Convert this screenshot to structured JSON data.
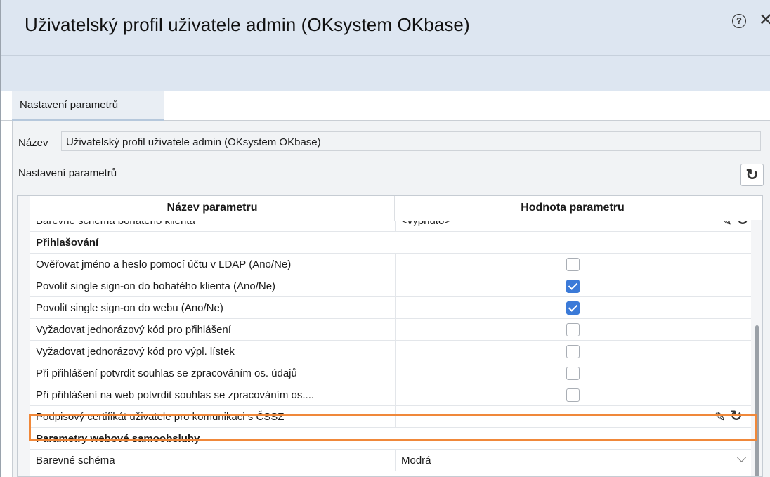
{
  "window": {
    "title": "Uživatelský profil uživatele admin (OKsystem OKbase)",
    "help_glyph": "?",
    "close_glyph": "✕"
  },
  "tabs": [
    {
      "label": "Nastavení parametrů",
      "active": true
    }
  ],
  "form": {
    "name_label": "Název",
    "name_value": "Uživatelský profil uživatele admin (OKsystem OKbase)",
    "section_label": "Nastavení parametrů"
  },
  "grid": {
    "columns": [
      "Název parametru",
      "Hodnota parametru"
    ],
    "partial_row": {
      "name": "Barevné schéma bohatého klienta",
      "value": "<vypnuto>"
    },
    "groups": [
      {
        "label": "Přihlašování",
        "rows": [
          {
            "name": "Ověřovat jméno a heslo pomocí účtu v LDAP (Ano/Ne)",
            "checked": false
          },
          {
            "name": "Povolit single sign-on do bohatého klienta (Ano/Ne)",
            "checked": true
          },
          {
            "name": "Povolit single sign-on do webu (Ano/Ne)",
            "checked": true
          },
          {
            "name": "Vyžadovat jednorázový kód pro přihlášení",
            "checked": false
          },
          {
            "name": "Vyžadovat jednorázový kód pro výpl. lístek",
            "checked": false
          },
          {
            "name": "Při přihlášení potvrdit souhlas se zpracováním os. údajů",
            "checked": false
          },
          {
            "name": "Při přihlášení na web potvrdit souhlas se zpracováním os....",
            "checked": false
          },
          {
            "name": "Podpisový certifikát uživatele pro komunikaci s ČSSZ",
            "value": "",
            "highlighted": true
          }
        ]
      },
      {
        "label": "Parametry webové samoobsluhy",
        "rows": [
          {
            "name": "Barevné schéma",
            "value": "Modrá"
          }
        ]
      }
    ]
  },
  "icons": {
    "pencil": "✎",
    "refresh": "↻"
  },
  "colors": {
    "title_bar": "#dde6f1",
    "checkbox_on": "#3b7ad8",
    "highlight": "#f0883a"
  }
}
